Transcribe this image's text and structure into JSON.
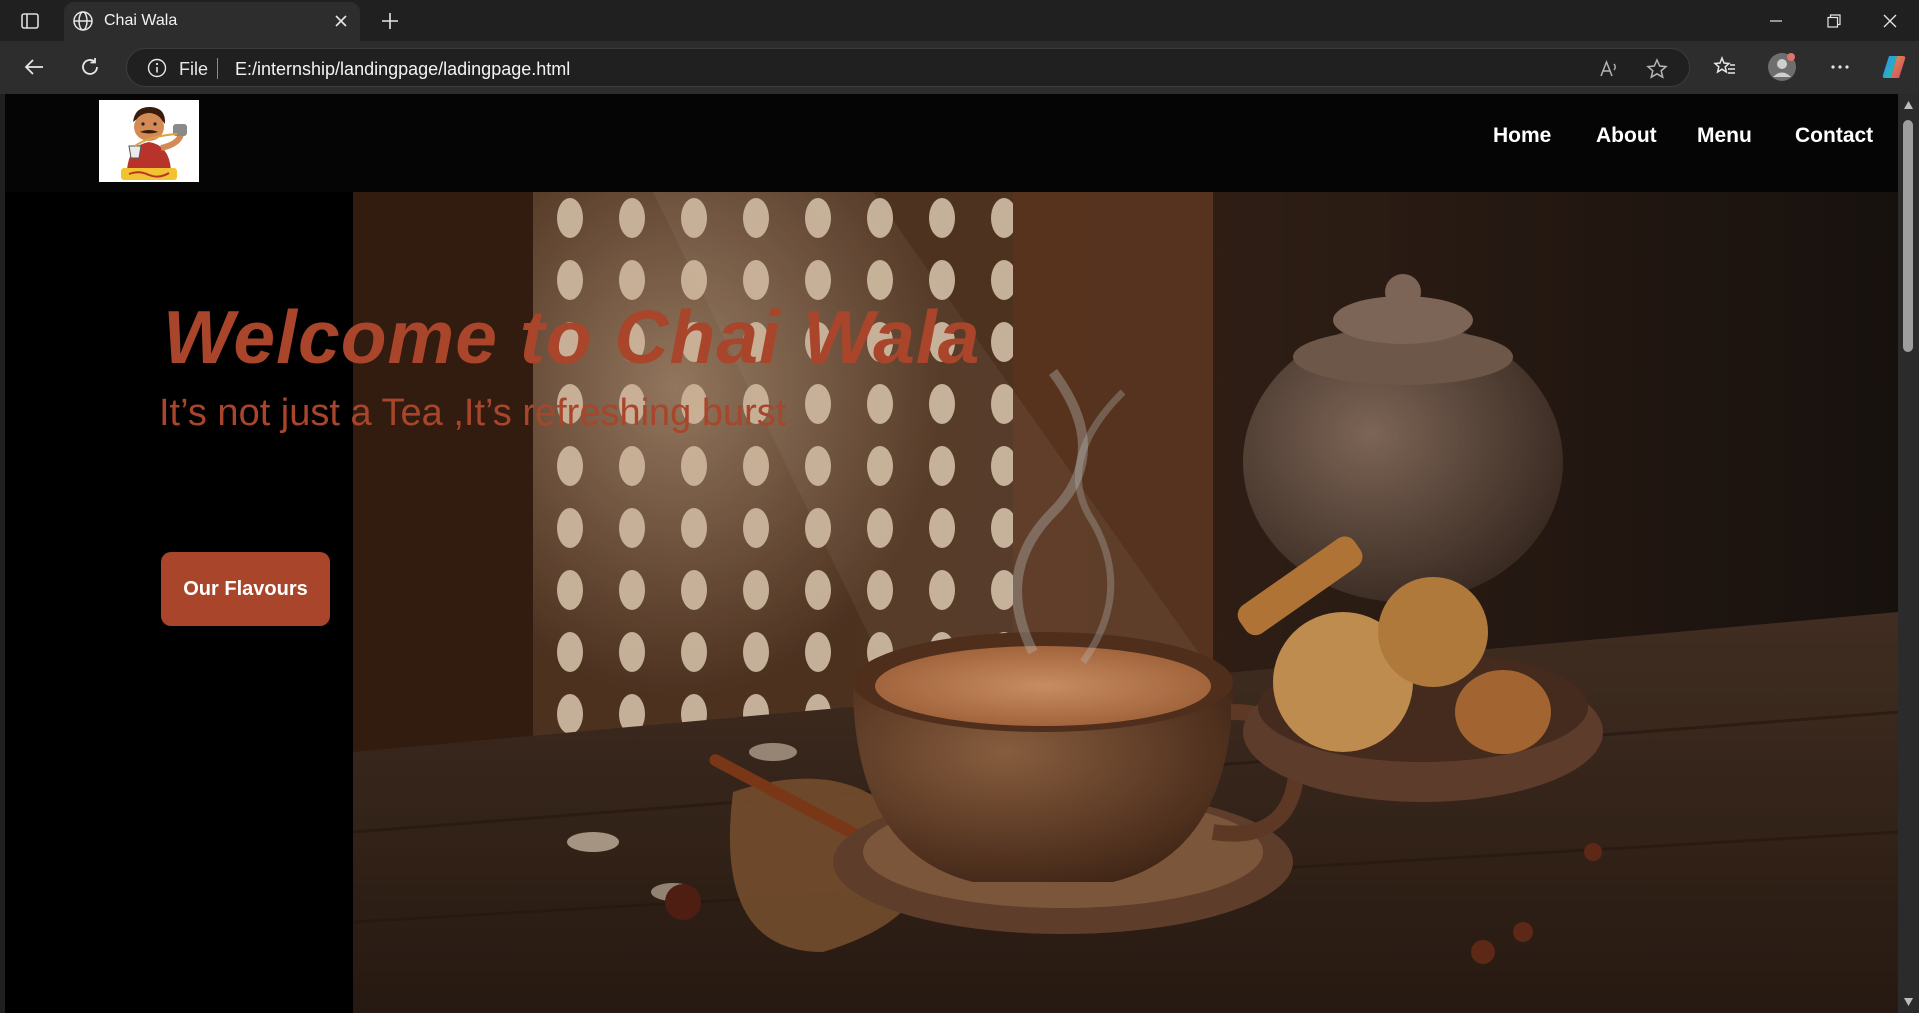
{
  "browser": {
    "tab_title": "Chai Wala",
    "address_scheme": "File",
    "address_url": "E:/internship/landingpage/ladingpage.html"
  },
  "nav": {
    "items": [
      {
        "label": "Home"
      },
      {
        "label": "About"
      },
      {
        "label": "Menu"
      },
      {
        "label": "Contact"
      }
    ]
  },
  "hero": {
    "title": "Welcome to Chai Wala",
    "subtitle": "It’s not just a Tea ,It’s refreshing burst",
    "button_label": "Our Flavours"
  },
  "colors": {
    "accent": "#a8452b",
    "page_background": "#000000",
    "chrome_dark": "#202020"
  },
  "icons": [
    "tab-actions-icon",
    "globe-icon",
    "close-icon",
    "plus-icon",
    "minimize-icon",
    "restore-icon",
    "back-icon",
    "refresh-icon",
    "info-icon",
    "read-aloud-icon",
    "star-icon",
    "favorites-icon",
    "profile-icon",
    "more-icon",
    "copilot-icon"
  ]
}
